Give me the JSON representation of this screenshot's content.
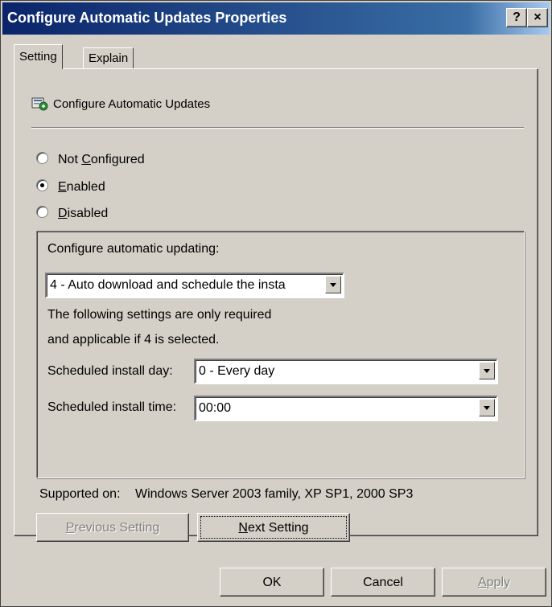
{
  "window": {
    "title": "Configure Automatic Updates Properties",
    "help_button": "?",
    "close_button": "×"
  },
  "tabs": [
    {
      "label": "Setting",
      "active": true
    },
    {
      "label": "Explain",
      "active": false
    }
  ],
  "policy": {
    "icon": "policy-setting-icon",
    "name": "Configure Automatic Updates"
  },
  "state": {
    "options": [
      {
        "pre": "Not ",
        "key": "C",
        "post": "onfigured",
        "checked": false
      },
      {
        "pre": "",
        "key": "E",
        "post": "nabled",
        "checked": true
      },
      {
        "pre": "",
        "key": "D",
        "post": "isabled",
        "checked": false
      }
    ]
  },
  "options": {
    "updating_label": "Configure automatic updating:",
    "updating_value": "4 - Auto download and schedule the insta",
    "note_line1": "The following settings are only required",
    "note_line2": "and applicable if 4 is selected.",
    "day_label": "Scheduled install day:",
    "day_value": "0 - Every day",
    "time_label": "Scheduled install time:",
    "time_value": "00:00"
  },
  "supported": {
    "label": "Supported on:",
    "value": "Windows Server 2003 family, XP SP1, 2000 SP3"
  },
  "nav": {
    "previous": {
      "pre": "",
      "key": "P",
      "post": "revious Setting",
      "enabled": false
    },
    "next": {
      "pre": "",
      "key": "N",
      "post": "ext Setting",
      "enabled": true
    }
  },
  "footer": {
    "ok": "OK",
    "cancel": "Cancel",
    "apply": {
      "pre": "",
      "key": "A",
      "post": "pply",
      "enabled": false
    }
  },
  "colors": {
    "title_start": "#0a246a",
    "title_end": "#a6caf0",
    "face": "#d4d0c8"
  }
}
